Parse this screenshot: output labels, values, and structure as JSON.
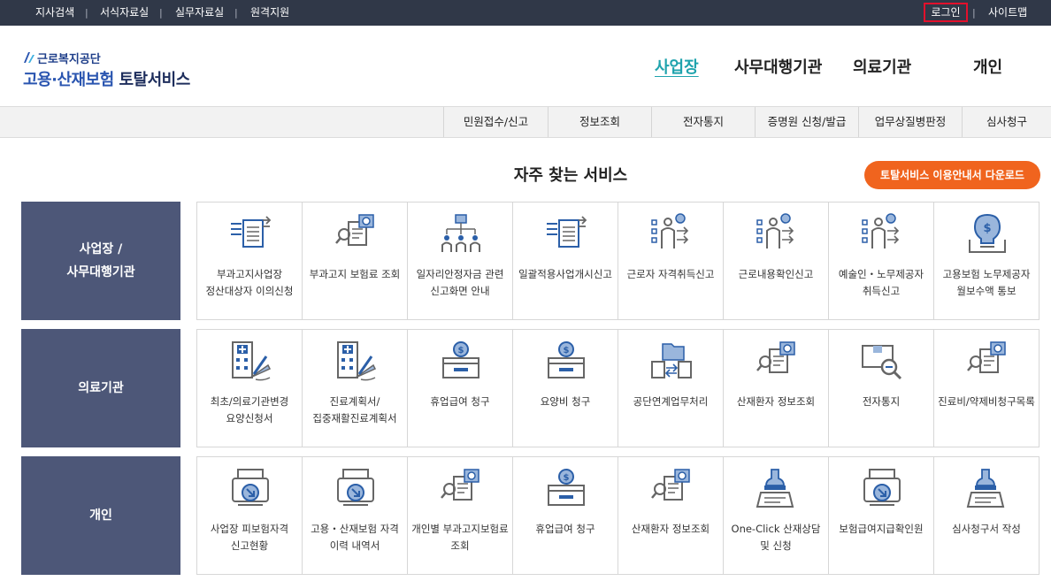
{
  "topbar": {
    "links": [
      "지사검색",
      "서식자료실",
      "실무자료실",
      "원격지원"
    ],
    "login": "로그인",
    "sitemap": "사이트맵",
    "separator": "|"
  },
  "logo": {
    "org": "근로복지공단",
    "service_blue": "고용·산재보험",
    "service_dark": "토탈서비스"
  },
  "gnb": {
    "items": [
      "사업장",
      "사무대행기관",
      "의료기관",
      "개인"
    ],
    "active": "사업장"
  },
  "subnav": [
    "민원접수/신고",
    "정보조회",
    "전자통지",
    "증명원 신청/발급",
    "업무상질병판정",
    "심사청구"
  ],
  "section": {
    "title": "자주 찾는 서비스",
    "download_button": "토탈서비스 이용안내서 다운로드"
  },
  "rows": [
    {
      "category": "사업장 /\n사무대행기관",
      "items": [
        {
          "label": "부과고지사업장 정산대상자 이의신청",
          "icon": "document-arrows-icon"
        },
        {
          "label": "부과고지 보험료 조회",
          "icon": "document-search-icon"
        },
        {
          "label": "일자리안정자금 관련 신고화면 안내",
          "icon": "org-chart-people-icon"
        },
        {
          "label": "일괄적용사업개시신고",
          "icon": "document-arrows-icon"
        },
        {
          "label": "근로자 자격취득신고",
          "icon": "person-checklist-icon"
        },
        {
          "label": "근로내용확인신고",
          "icon": "person-checklist-icon"
        },
        {
          "label": "예술인・노무제공자 취득신고",
          "icon": "person-checklist-icon"
        },
        {
          "label": "고용보험 노무제공자 월보수액 통보",
          "icon": "money-bulb-icon"
        }
      ]
    },
    {
      "category": "의료기관",
      "items": [
        {
          "label": "최초/의료기관변경 요양신청서",
          "icon": "hospital-pen-icon"
        },
        {
          "label": "진료계획서/집중재활진료계획서",
          "icon": "hospital-pen-icon"
        },
        {
          "label": "휴업급여 청구",
          "icon": "coin-box-icon"
        },
        {
          "label": "요양비 청구",
          "icon": "coin-box-icon"
        },
        {
          "label": "공단연계업무처리",
          "icon": "folder-exchange-icon"
        },
        {
          "label": "산재환자 정보조회",
          "icon": "document-search-icon"
        },
        {
          "label": "전자통지",
          "icon": "box-magnifier-icon"
        },
        {
          "label": "진료비/약제비청구목록",
          "icon": "document-search-icon"
        }
      ]
    },
    {
      "category": "개인",
      "items": [
        {
          "label": "사업장 피보험자격 신고현황",
          "icon": "printer-arrow-icon"
        },
        {
          "label": "고용・산재보험 자격 이력 내역서",
          "icon": "printer-arrow-icon"
        },
        {
          "label": "개인별 부과고지보험료 조회",
          "icon": "document-search-icon"
        },
        {
          "label": "휴업급여 청구",
          "icon": "coin-box-icon"
        },
        {
          "label": "산재환자 정보조회",
          "icon": "document-search-icon"
        },
        {
          "label": "One-Click 산재상담 및 신청",
          "icon": "stamp-document-icon"
        },
        {
          "label": "보험급여지급확인원",
          "icon": "printer-arrow-icon"
        },
        {
          "label": "심사청구서 작성",
          "icon": "stamp-document-icon"
        }
      ]
    }
  ],
  "colors": {
    "topbar": "#303848",
    "category": "#4d5778",
    "accent": "#1fa3ad",
    "download": "#f0641e",
    "login_highlight": "#e3102c",
    "icon_blue": "#2b5fa8",
    "icon_gray": "#666666"
  }
}
